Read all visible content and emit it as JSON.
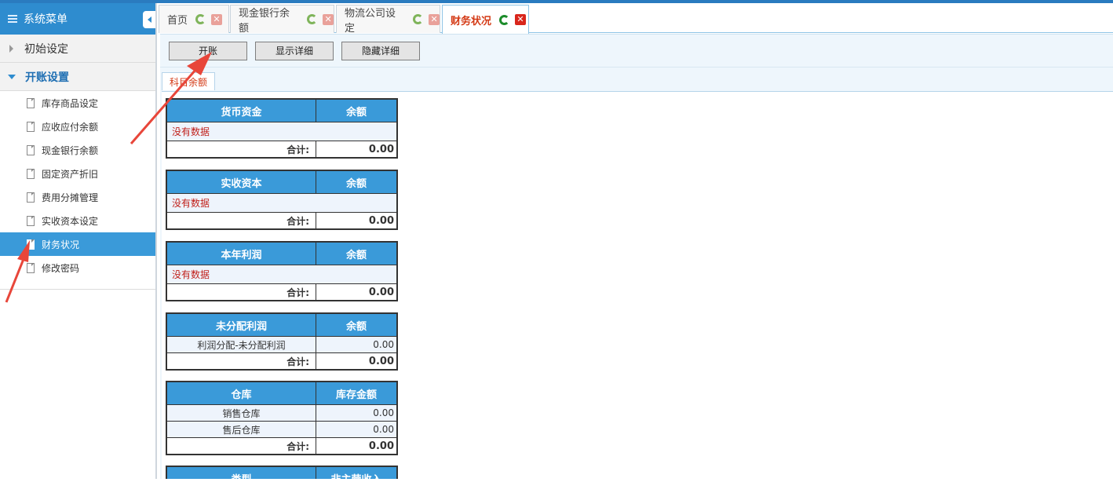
{
  "sidebar": {
    "title": "系统菜单",
    "groups": [
      {
        "label": "初始设定"
      },
      {
        "label": "开账设置"
      }
    ],
    "items": [
      {
        "label": "库存商品设定"
      },
      {
        "label": "应收应付余额"
      },
      {
        "label": "现金银行余额"
      },
      {
        "label": "固定资产折旧"
      },
      {
        "label": "费用分摊管理"
      },
      {
        "label": "实收资本设定"
      },
      {
        "label": "财务状况"
      },
      {
        "label": "修改密码"
      }
    ]
  },
  "tabs": [
    {
      "label": "首页"
    },
    {
      "label": "现金银行余额"
    },
    {
      "label": "物流公司设定"
    },
    {
      "label": "财务状况"
    }
  ],
  "toolbar": {
    "open_label": "开账",
    "show_label": "显示详细",
    "hide_label": "隐藏详细"
  },
  "subtab": {
    "label": "科目余额"
  },
  "tables": [
    {
      "col1": "货币资金",
      "col2": "余额",
      "nodata": "没有数据",
      "total_label": "合计:",
      "total": "0.00"
    },
    {
      "col1": "实收资本",
      "col2": "余额",
      "nodata": "没有数据",
      "total_label": "合计:",
      "total": "0.00"
    },
    {
      "col1": "本年利润",
      "col2": "余额",
      "nodata": "没有数据",
      "total_label": "合计:",
      "total": "0.00"
    },
    {
      "col1": "未分配利润",
      "col2": "余额",
      "rows": [
        {
          "name": "利润分配-未分配利润",
          "value": "0.00"
        }
      ],
      "total_label": "合计:",
      "total": "0.00"
    },
    {
      "col1": "仓库",
      "col2": "库存金额",
      "rows": [
        {
          "name": "销售仓库",
          "value": "0.00"
        },
        {
          "name": "售后仓库",
          "value": "0.00"
        }
      ],
      "total_label": "合计:",
      "total": "0.00"
    },
    {
      "col1": "类型",
      "col2": "非主营收入"
    }
  ],
  "colors": {
    "accent": "#2e8ccf",
    "active_tab": "#d43a16",
    "annotation_arrow": "#e8463a"
  }
}
